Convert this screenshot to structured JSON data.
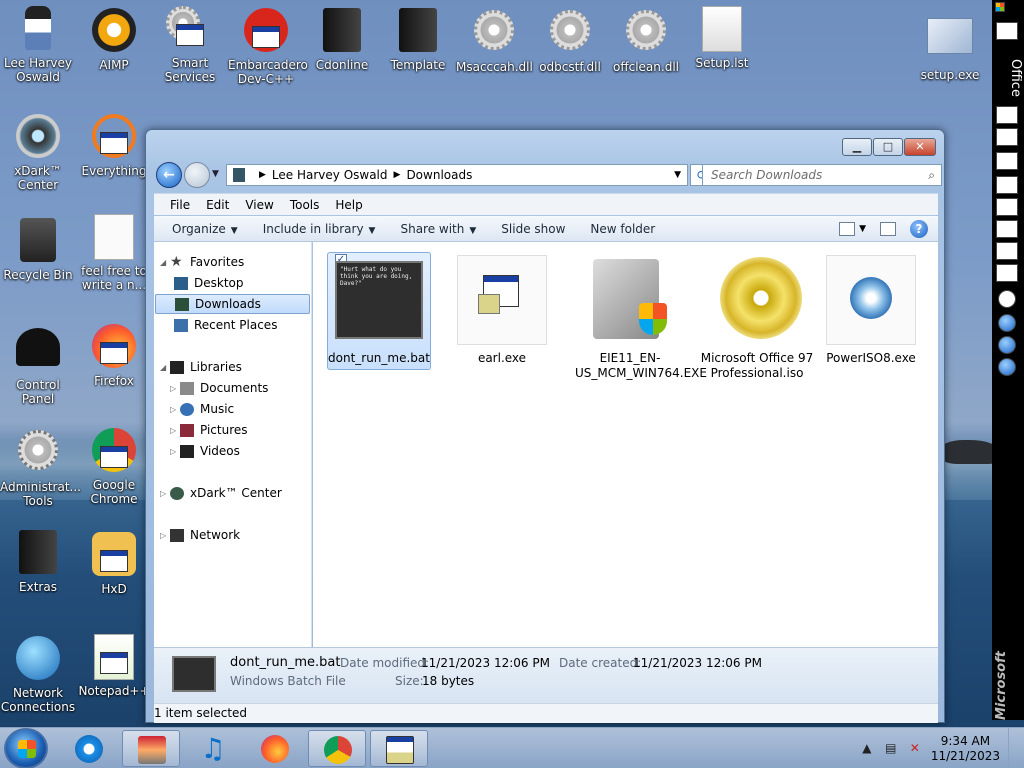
{
  "desktop": {
    "icons": [
      {
        "label": "Lee Harvey Oswald"
      },
      {
        "label": "AIMP"
      },
      {
        "label": "Smart Services"
      },
      {
        "label": "Embarcadero Dev-C++"
      },
      {
        "label": "Cdonline"
      },
      {
        "label": "Template"
      },
      {
        "label": "Msacccah.dll"
      },
      {
        "label": "odbcstf.dll"
      },
      {
        "label": "offclean.dll"
      },
      {
        "label": "Setup.lst"
      },
      {
        "label": "setup.exe"
      },
      {
        "label": "xDark™ Center"
      },
      {
        "label": "Everything"
      },
      {
        "label": "Recycle Bin"
      },
      {
        "label": "feel free to write a n..."
      },
      {
        "label": "Control Panel"
      },
      {
        "label": "Firefox"
      },
      {
        "label": "Administrat... Tools"
      },
      {
        "label": "Google Chrome"
      },
      {
        "label": "Extras"
      },
      {
        "label": "HxD"
      },
      {
        "label": "Network Connections"
      },
      {
        "label": "Notepad++"
      }
    ]
  },
  "explorer": {
    "address": {
      "crumbs": [
        "Lee Harvey Oswald",
        "Downloads"
      ],
      "search_placeholder": "Search Downloads"
    },
    "menu": [
      "File",
      "Edit",
      "View",
      "Tools",
      "Help"
    ],
    "commands": [
      {
        "label": "Organize",
        "dropdown": true
      },
      {
        "label": "Include in library",
        "dropdown": true
      },
      {
        "label": "Share with",
        "dropdown": true
      },
      {
        "label": "Slide show",
        "dropdown": false
      },
      {
        "label": "New folder",
        "dropdown": false
      }
    ],
    "nav": {
      "favorites": "Favorites",
      "desktop": "Desktop",
      "downloads": "Downloads",
      "recent": "Recent Places",
      "libraries": "Libraries",
      "documents": "Documents",
      "music": "Music",
      "pictures": "Pictures",
      "videos": "Videos",
      "xdark": "xDark™ Center",
      "network": "Network"
    },
    "files": [
      {
        "name": "dont_run_me.bat",
        "preview": "\"Hurt what do you think you are doing, Dave?\"",
        "selected": true
      },
      {
        "name": "earl.exe"
      },
      {
        "name": "EIE11_EN-US_MCM_WIN764.EXE"
      },
      {
        "name": "Microsoft Office 97 Professional.iso"
      },
      {
        "name": "PowerISO8.exe"
      }
    ],
    "details": {
      "name": "dont_run_me.bat",
      "type": "Windows Batch File",
      "modified_label": "Date modified:",
      "modified": "11/21/2023 12:06 PM",
      "created_label": "Date created:",
      "created": "11/21/2023 12:06 PM",
      "size_label": "Size:",
      "size": "18 bytes"
    },
    "status": "1 item selected"
  },
  "officebar": {
    "title": "Office",
    "brand": "Microsoft"
  },
  "taskbar": {
    "time": "9:34 AM",
    "date": "11/21/2023"
  },
  "colors": {
    "accent": "#1a63c6",
    "selection": "#c9e0fc"
  }
}
